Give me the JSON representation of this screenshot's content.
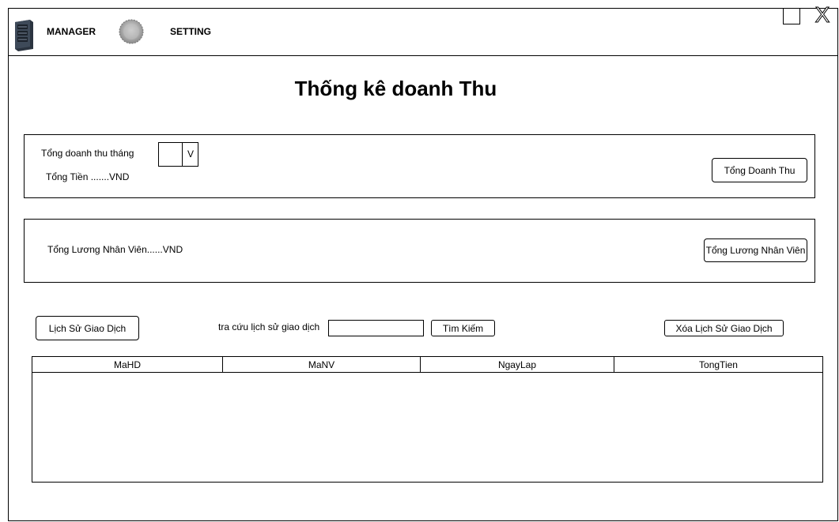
{
  "nav": {
    "manager_label": "MANAGER",
    "setting_label": "SETTING"
  },
  "window_controls": {
    "close_glyph": "X"
  },
  "page": {
    "title": "Thống kê doanh Thu"
  },
  "revenue_panel": {
    "month_label": "Tổng doanh thu tháng",
    "month_dropdown_arrow": "V",
    "total_label": "Tổng Tiền .......VND",
    "total_button": "Tổng Doanh Thu"
  },
  "salary_panel": {
    "salary_label": "Tổng Lương Nhân Viên......VND",
    "salary_button": "Tổng Lương Nhân Viên"
  },
  "history": {
    "history_button": "Lịch Sử Giao Dịch",
    "search_label": "tra cứu lịch sử giao dịch",
    "search_value": "",
    "search_button": "Tìm Kiếm",
    "delete_button": "Xóa Lịch Sử Giao Dịch"
  },
  "table": {
    "columns": [
      "MaHD",
      "MaNV",
      "NgayLap",
      "TongTien"
    ],
    "rows": []
  },
  "colors": {
    "border": "#000000",
    "background": "#ffffff"
  }
}
